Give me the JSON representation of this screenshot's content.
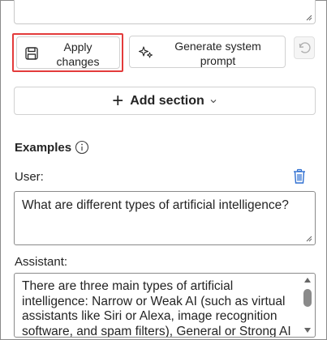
{
  "toolbar": {
    "apply_label": "Apply changes",
    "generate_label": "Generate system prompt"
  },
  "add_section": {
    "label": "Add section"
  },
  "examples": {
    "title": "Examples",
    "user_label": "User:",
    "user_message": "What are different types of artificial intelligence?",
    "assistant_label": "Assistant:",
    "assistant_message": "There are three main types of artificial intelligence: Narrow or Weak AI (such as virtual assistants like Siri or Alexa, image recognition software, and spam filters), General or Strong AI"
  },
  "icons": {
    "apply": "save-icon",
    "generate": "sparkle-icon",
    "undo": "undo-icon",
    "add": "plus-icon",
    "info": "info-icon",
    "delete": "trash-icon"
  },
  "colors": {
    "highlight": "#e33b3b",
    "trash": "#2f6fd1"
  }
}
